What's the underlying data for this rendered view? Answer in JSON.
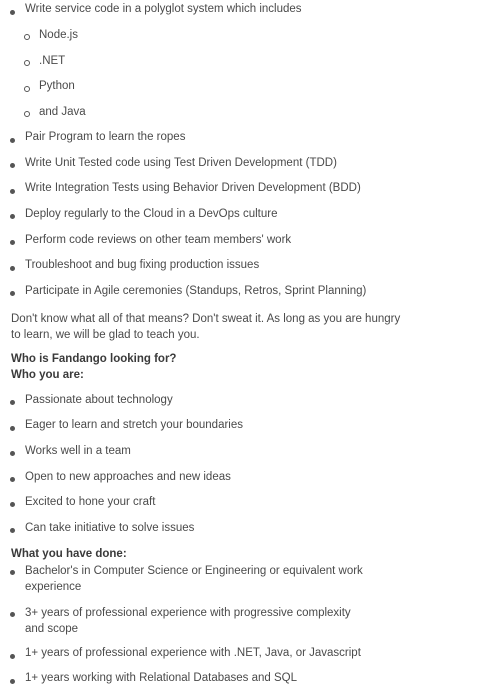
{
  "responsibilities": {
    "polyglot_intro": "Write service code in a polyglot system which includes",
    "languages": [
      "Node.js",
      ".NET",
      "Python",
      "and Java"
    ],
    "items": [
      "Pair Program to learn the ropes",
      "Write Unit Tested code using Test Driven Development (TDD)",
      "Write Integration Tests using Behavior Driven Development (BDD)",
      "Deploy regularly to the Cloud in a DevOps culture",
      "Perform code reviews on other team members' work",
      "Troubleshoot and bug fixing production issues",
      "Participate in Agile ceremonies (Standups, Retros, Sprint Planning)"
    ]
  },
  "reassurance": "Don't know what all of that means? Don't sweat it. As long as you are hungry to learn, we will be glad to teach you.",
  "looking_for": {
    "heading": "Who is Fandango looking for?",
    "subheading": "Who you are:",
    "items": [
      "Passionate about technology",
      "Eager to learn and stretch your boundaries",
      "Works well in a team",
      "Open to new approaches and new ideas",
      "Excited to hone your craft",
      "Can take initiative to solve issues"
    ]
  },
  "done": {
    "heading": "What you have done:",
    "items": [
      "Bachelor's in Computer Science or Engineering or equivalent work experience",
      "3+ years of professional experience with progressive complexity and scope",
      "1+ years of professional experience with .NET, Java, or Javascript",
      "1+ years working with Relational Databases and SQL"
    ]
  }
}
